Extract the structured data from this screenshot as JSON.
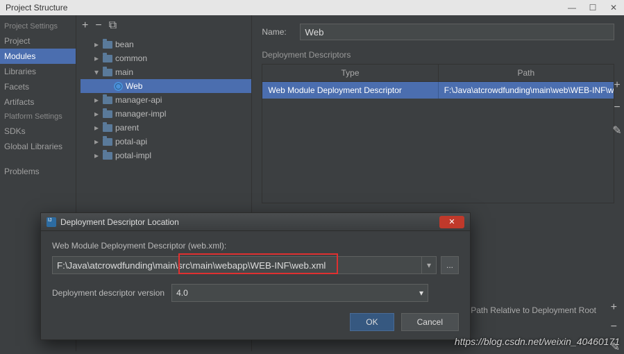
{
  "window": {
    "title": "Project Structure"
  },
  "sidebar": {
    "heading1": "Project Settings",
    "items1": [
      "Project",
      "Modules",
      "Libraries",
      "Facets",
      "Artifacts"
    ],
    "selected1": 1,
    "heading2": "Platform Settings",
    "items2": [
      "SDKs",
      "Global Libraries"
    ],
    "heading3": "",
    "items3": [
      "Problems"
    ]
  },
  "tree": {
    "toolbar": {
      "add": "+",
      "remove": "−",
      "copy": "⧉"
    },
    "nodes": [
      {
        "label": "bean",
        "depth": 1,
        "type": "folder"
      },
      {
        "label": "common",
        "depth": 1,
        "type": "folder"
      },
      {
        "label": "main",
        "depth": 1,
        "type": "folder",
        "caret": "open"
      },
      {
        "label": "Web",
        "depth": 2,
        "type": "web",
        "selected": true
      },
      {
        "label": "manager-api",
        "depth": 1,
        "type": "folder"
      },
      {
        "label": "manager-impl",
        "depth": 1,
        "type": "folder"
      },
      {
        "label": "parent",
        "depth": 1,
        "type": "folder"
      },
      {
        "label": "potal-api",
        "depth": 1,
        "type": "folder"
      },
      {
        "label": "potal-impl",
        "depth": 1,
        "type": "folder"
      }
    ]
  },
  "detail": {
    "name_label": "Name:",
    "name_value": "Web",
    "section": "Deployment Descriptors",
    "col_type": "Type",
    "col_path": "Path",
    "row_type": "Web Module Deployment Descriptor",
    "row_path": "F:\\Java\\atcrowdfunding\\main\\web\\WEB-INF\\web.xml",
    "bottom_label": "Path Relative to Deployment Root"
  },
  "modal": {
    "title": "Deployment Descriptor Location",
    "label_path": "Web Module Deployment Descriptor (web.xml):",
    "path_value": "F:\\Java\\atcrowdfunding\\main\\src\\main\\webapp\\WEB-INF\\web.xml",
    "label_version": "Deployment descriptor version",
    "version_value": "4.0",
    "ok": "OK",
    "cancel": "Cancel",
    "browse": "..."
  },
  "watermark": "https://blog.csdn.net/weixin_40460171"
}
